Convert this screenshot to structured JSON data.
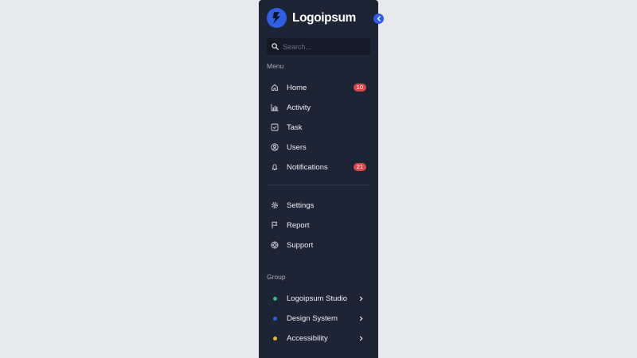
{
  "brand": {
    "name": "Logoipsum",
    "logo_icon": "bolt-icon",
    "accent": "#2f5fe3"
  },
  "collapse_button": {
    "icon": "chevron-left-icon"
  },
  "search": {
    "placeholder": "Search...",
    "value": "",
    "icon": "search-icon"
  },
  "menu": {
    "label": "Menu",
    "items": [
      {
        "label": "Home",
        "icon": "home-icon",
        "badge": "10"
      },
      {
        "label": "Activity",
        "icon": "bar-chart-icon"
      },
      {
        "label": "Task",
        "icon": "checkbox-icon"
      },
      {
        "label": "Users",
        "icon": "user-circle-icon"
      },
      {
        "label": "Notifications",
        "icon": "bell-icon",
        "badge": "21"
      }
    ]
  },
  "secondary": {
    "items": [
      {
        "label": "Settings",
        "icon": "gear-icon"
      },
      {
        "label": "Report",
        "icon": "flag-icon"
      },
      {
        "label": "Support",
        "icon": "lifebuoy-icon"
      }
    ]
  },
  "group": {
    "label": "Group",
    "items": [
      {
        "label": "Logoipsum Studio",
        "dot_color": "#3fb27f"
      },
      {
        "label": "Design System",
        "dot_color": "#2f5fe3"
      },
      {
        "label": "Accessibility",
        "dot_color": "#e8b53c"
      }
    ]
  },
  "colors": {
    "sidebar_bg": "#1d2434",
    "page_bg": "#e8e9ec",
    "badge_bg": "#d9484b"
  }
}
